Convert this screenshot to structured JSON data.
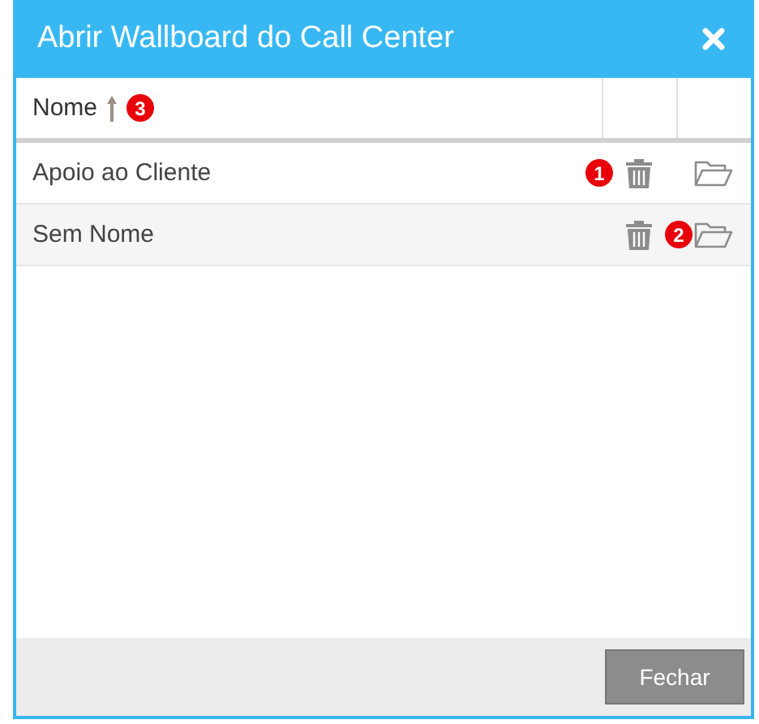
{
  "window": {
    "title": "Abrir Wallboard do Call Center"
  },
  "table": {
    "header": {
      "label": "Nome",
      "sorted_ascending": true,
      "badge": "3"
    },
    "rows": [
      {
        "name": "Apoio ao Cliente",
        "delete_badge": "1"
      },
      {
        "name": "Sem Nome",
        "open_badge": "2"
      }
    ]
  },
  "footer": {
    "button": "Fechar"
  }
}
